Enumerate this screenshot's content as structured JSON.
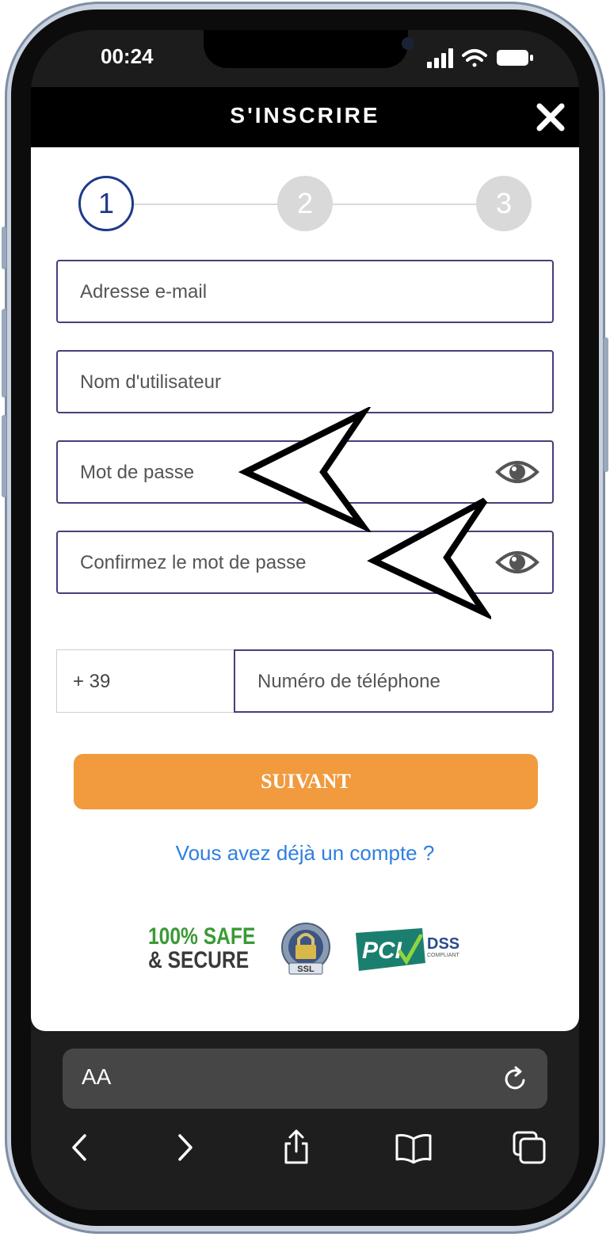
{
  "status": {
    "time": "00:24"
  },
  "header": {
    "title": "S'INSCRIRE"
  },
  "stepper": {
    "steps": [
      "1",
      "2",
      "3"
    ]
  },
  "form": {
    "email_placeholder": "Adresse e-mail",
    "username_placeholder": "Nom d'utilisateur",
    "password_placeholder": "Mot de passe",
    "confirm_placeholder": "Confirmez le mot de passe",
    "phone_prefix": "+ 39",
    "phone_placeholder": "Numéro de téléphone"
  },
  "actions": {
    "next_label": "SUIVANT",
    "login_link": "Vous avez déjà un compte ?"
  },
  "badges": {
    "safe_line1": "100% SAFE",
    "safe_line2": "& SECURE",
    "ssl_label": "SSL",
    "pci_label": "PCI",
    "dss_label": "DSS",
    "compliant_label": "COMPLIANT"
  },
  "browser": {
    "aa_label": "AA"
  },
  "colors": {
    "accent_orange": "#f19a3e",
    "active_step": "#1e3a8a",
    "field_border": "#4a3d7a",
    "link_blue": "#2f7fe0",
    "safe_green": "#3a9a35"
  },
  "icons": [
    "close-icon",
    "eye-icon",
    "ssl-lock-icon",
    "pci-dss-icon",
    "reload-icon",
    "back-icon",
    "forward-icon",
    "share-icon",
    "bookmarks-icon",
    "tabs-icon"
  ]
}
